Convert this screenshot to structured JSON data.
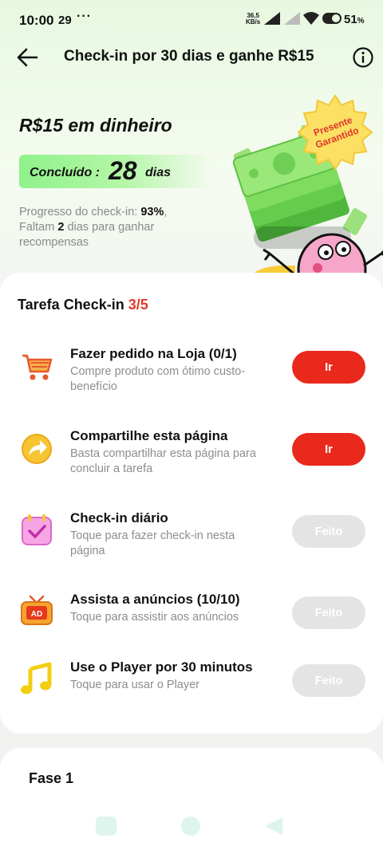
{
  "status_bar": {
    "time": "10:00",
    "date": "29",
    "dots": "···",
    "speed_value": "36,5",
    "speed_unit": "KB/s",
    "battery": "51",
    "battery_unit": "%"
  },
  "header": {
    "title": "Check-in por 30 dias e ganhe R$15",
    "back_icon": "arrow-left-icon",
    "info_icon": "info-icon"
  },
  "hero": {
    "title": "R$15 em dinheiro",
    "completed_label": "Concluído :",
    "completed_days": "28",
    "completed_unit": "dias",
    "progress_prefix": "Progresso do check-in: ",
    "progress_value": "93%",
    "progress_suffix": ",",
    "remaining_prefix": "Faltam ",
    "remaining_value": "2",
    "remaining_suffix": " dias para ganhar recompensas",
    "progress_percent": 93,
    "badge_line1": "Presente",
    "badge_line2": "Garantido"
  },
  "tasks": {
    "heading_label": "Tarefa Check-in ",
    "heading_count": "3/5",
    "items": [
      {
        "title": "Fazer pedido na Loja  (0/1)",
        "desc": "Compre produto com ótimo custo-benefício",
        "button": "Ir",
        "icon": "shopping-cart-icon"
      },
      {
        "title": "Compartilhe esta página",
        "desc": "Basta compartilhar esta página para concluir a tarefa",
        "button": "Ir",
        "icon": "share-arrow-icon"
      },
      {
        "title": "Check-in diário",
        "desc": "Toque para fazer check-in nesta página",
        "button": "Feito",
        "icon": "calendar-check-icon"
      },
      {
        "title": "Assista a anúncios  (10/10)",
        "desc": "Toque para assistir aos anúncios",
        "button": "Feito",
        "icon": "ad-tv-icon"
      },
      {
        "title": "Use o Player por 30 minutos",
        "desc": "Toque para usar o Player",
        "button": "Feito",
        "icon": "music-note-icon"
      }
    ]
  },
  "phase": {
    "title": "Fase 1"
  },
  "colors": {
    "accent_red": "#e8291c",
    "done_gray": "#e4e4e4",
    "count_red": "#e03a2c",
    "pill_green": "#8ff28a"
  }
}
